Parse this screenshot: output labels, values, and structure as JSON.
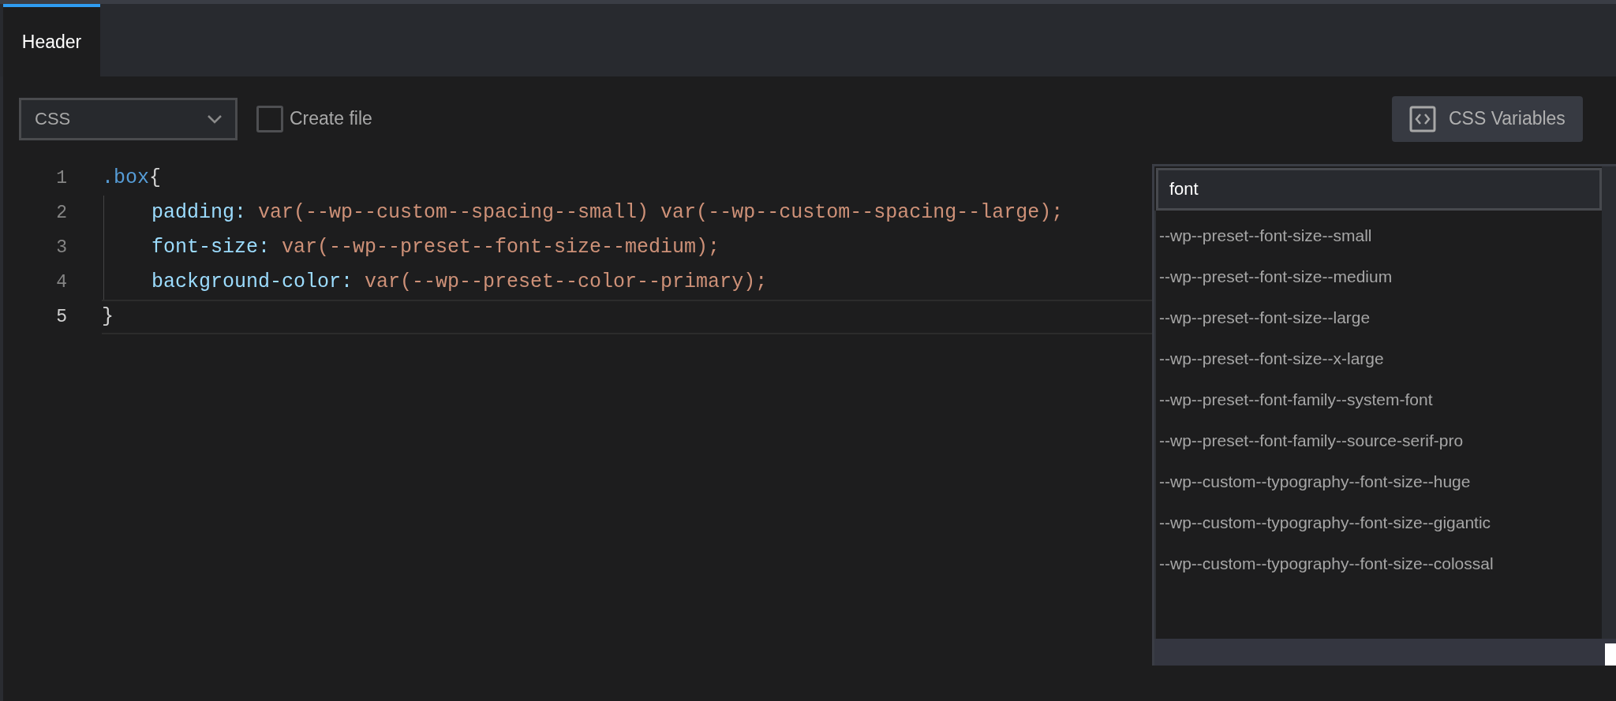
{
  "tabs": [
    {
      "label": "Header",
      "selected": true
    }
  ],
  "toolbar": {
    "language_select": {
      "value": "CSS"
    },
    "create_file": {
      "label": "Create file",
      "checked": false
    },
    "variables_button": {
      "label": "CSS Variables"
    }
  },
  "editor": {
    "lines": [
      {
        "number": "1",
        "current": false,
        "indented": false,
        "tokens": [
          {
            "kind": "selector",
            "text": ".box"
          },
          {
            "kind": "punct",
            "text": "{"
          }
        ]
      },
      {
        "number": "2",
        "current": false,
        "indented": true,
        "tokens": [
          {
            "kind": "property",
            "text": "padding:"
          },
          {
            "kind": "value",
            "text": " var(--wp--custom--spacing--small) var(--wp--custom--spacing--large);"
          }
        ]
      },
      {
        "number": "3",
        "current": false,
        "indented": true,
        "tokens": [
          {
            "kind": "property",
            "text": "font-size:"
          },
          {
            "kind": "value",
            "text": " var(--wp--preset--font-size--medium);"
          }
        ]
      },
      {
        "number": "4",
        "current": false,
        "indented": true,
        "tokens": [
          {
            "kind": "property",
            "text": "background-color:"
          },
          {
            "kind": "value",
            "text": " var(--wp--preset--color--primary);"
          }
        ]
      },
      {
        "number": "5",
        "current": true,
        "indented": false,
        "tokens": [
          {
            "kind": "punct",
            "text": "}"
          }
        ]
      }
    ]
  },
  "variables_popup": {
    "search": {
      "value": "font"
    },
    "items": [
      "--wp--preset--font-size--small",
      "--wp--preset--font-size--medium",
      "--wp--preset--font-size--large",
      "--wp--preset--font-size--x-large",
      "--wp--preset--font-family--system-font",
      "--wp--preset--font-family--source-serif-pro",
      "--wp--custom--typography--font-size--huge",
      "--wp--custom--typography--font-size--gigantic",
      "--wp--custom--typography--font-size--colossal"
    ]
  }
}
